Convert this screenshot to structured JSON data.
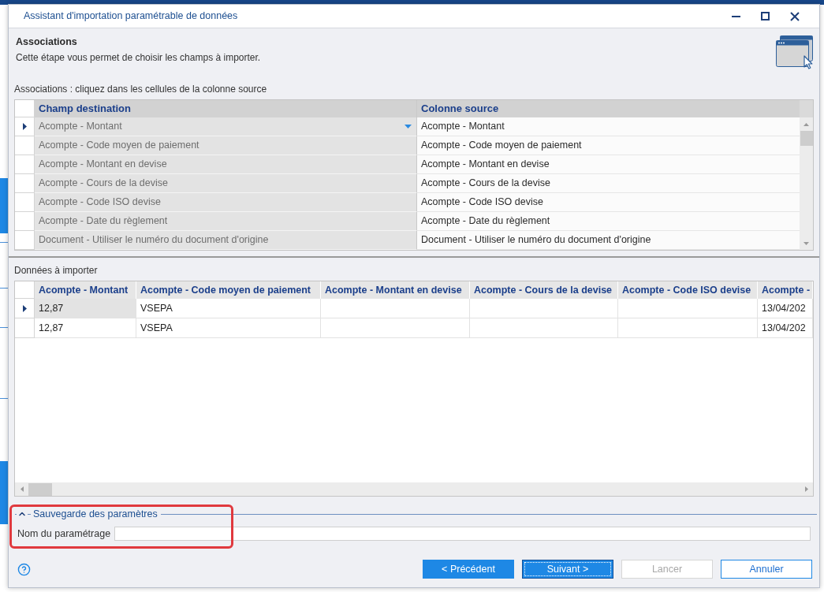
{
  "window": {
    "title": "Assistant d'importation paramétrable de données"
  },
  "step": {
    "title": "Associations",
    "description": "Cette étape vous permet de choisir les champs à importer."
  },
  "associations": {
    "label": "Associations : cliquez dans les cellules de la colonne source",
    "columns": [
      "Champ destination",
      "Colonne source"
    ],
    "rows": [
      {
        "destination": "Acompte - Montant",
        "source": "Acompte - Montant",
        "selected": true
      },
      {
        "destination": "Acompte - Code moyen de paiement",
        "source": "Acompte - Code moyen de paiement",
        "selected": false
      },
      {
        "destination": "Acompte - Montant en devise",
        "source": "Acompte - Montant en devise",
        "selected": false
      },
      {
        "destination": "Acompte - Cours de la devise",
        "source": "Acompte - Cours de la devise",
        "selected": false
      },
      {
        "destination": "Acompte - Code ISO devise",
        "source": "Acompte - Code ISO devise",
        "selected": false
      },
      {
        "destination": "Acompte - Date du règlement",
        "source": "Acompte - Date du règlement",
        "selected": false
      },
      {
        "destination": "Document - Utiliser le numéro du document d'origine",
        "source": "Document - Utiliser le numéro du document d'origine",
        "selected": false
      }
    ]
  },
  "import_data": {
    "label": "Données à importer",
    "columns": [
      "Acompte - Montant",
      "Acompte - Code moyen de paiement",
      "Acompte - Montant en devise",
      "Acompte - Cours de la devise",
      "Acompte - Code ISO devise",
      "Acompte -"
    ],
    "rows": [
      {
        "cells": [
          "12,87",
          "VSEPA",
          null,
          null,
          null,
          "13/04/202"
        ],
        "selected": true
      },
      {
        "cells": [
          "12,87",
          "VSEPA",
          null,
          null,
          null,
          "13/04/202"
        ],
        "selected": false
      }
    ]
  },
  "settings": {
    "title": "Sauvegarde des paramètres",
    "expanded": true,
    "name_label": "Nom du paramétrage"
  },
  "buttons": [
    {
      "label": "< Précédent",
      "kind": "primary",
      "disabled": false,
      "focused": false
    },
    {
      "label": "Suivant >",
      "kind": "primary",
      "disabled": false,
      "focused": true
    },
    {
      "label": "Lancer",
      "kind": "secondary",
      "disabled": true,
      "focused": false
    },
    {
      "label": "Annuler",
      "kind": "cancel",
      "disabled": false,
      "focused": false
    }
  ],
  "annotation": {
    "kind": "highlight_frame"
  }
}
